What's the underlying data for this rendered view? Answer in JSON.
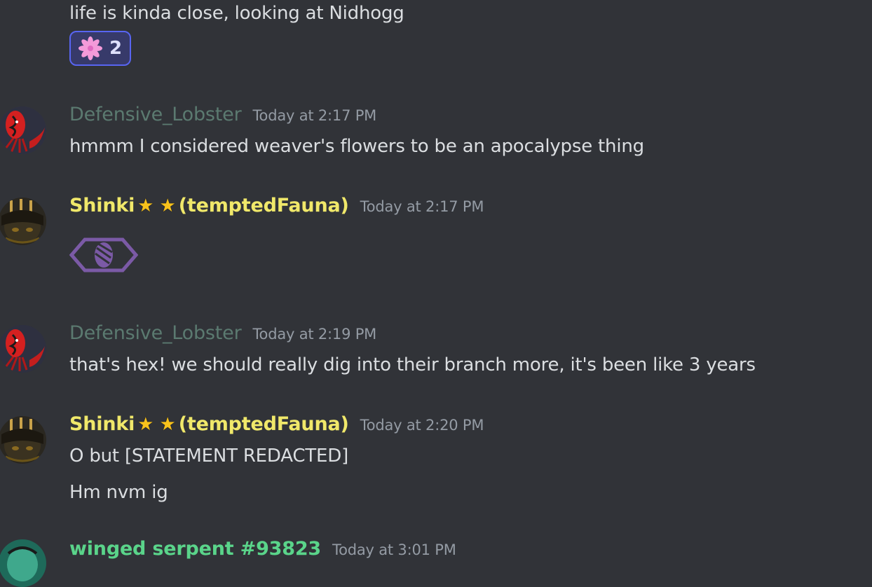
{
  "messages": {
    "m0": {
      "text": "life is kinda close, looking at Nidhogg"
    },
    "reaction": {
      "emoji": "pink-flower-icon",
      "count": "2"
    },
    "m1": {
      "username": "Defensive_Lobster",
      "timestamp": "Today at 2:17 PM",
      "text": "hmmm I considered weaver's flowers to be an apocalypse thing"
    },
    "m2": {
      "username_prefix": "Shinki",
      "username_suffix": "(temptedFauna)",
      "timestamp": "Today at 2:17 PM",
      "emoji": "purple-eye-sigil-icon"
    },
    "m3": {
      "username": "Defensive_Lobster",
      "timestamp": "Today at 2:19 PM",
      "text": "that's hex! we should really dig into their branch more, it's been like 3 years"
    },
    "m4": {
      "username_prefix": "Shinki",
      "username_suffix": "(temptedFauna)",
      "timestamp": "Today at 2:20 PM",
      "text1": "O but [STATEMENT REDACTED]",
      "text2": "Hm nvm ig"
    },
    "m5": {
      "username": "winged serpent #93823",
      "timestamp": "Today at 3:01 PM"
    }
  },
  "icons": {
    "star": "★"
  },
  "colors": {
    "background": "#313338",
    "lobster_name": "#5b7a70",
    "shinki_name": "#f0e86a",
    "winged_name": "#5ad48a",
    "reaction_border": "#5865f2",
    "star": "#f8c21c"
  }
}
